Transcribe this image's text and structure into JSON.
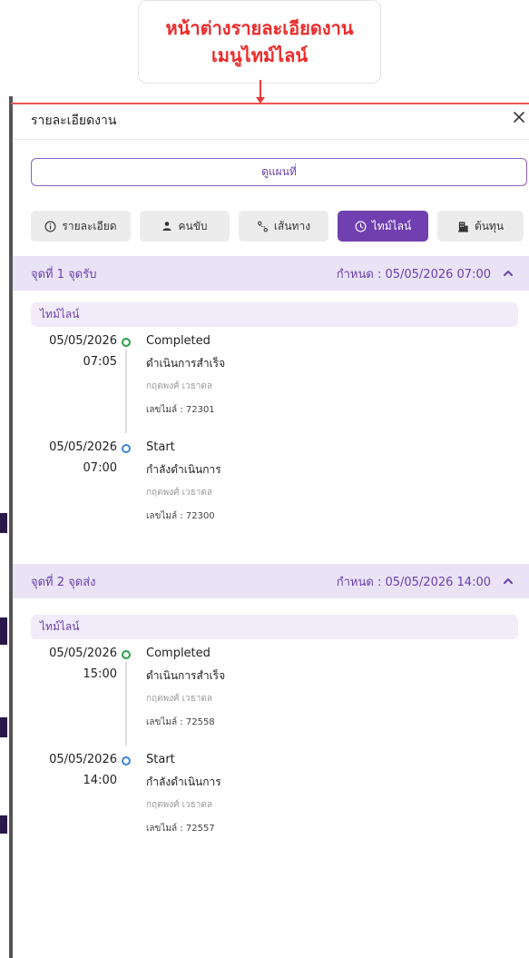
{
  "annotation": {
    "line1": "หน้าต่างรายละเอียดงาน",
    "line2": "เมนูไทม์ไลน์",
    "color": "#ec2b2b"
  },
  "panel": {
    "title": "รายละเอียดงาน",
    "close_icon": "close-icon",
    "map_button": "ดูแผนที่",
    "tabs": [
      {
        "label": "รายละเอียด",
        "icon": "info-icon",
        "active": false
      },
      {
        "label": "คนขับ",
        "icon": "person-icon",
        "active": false
      },
      {
        "label": "เส้นทาง",
        "icon": "route-icon",
        "active": false
      },
      {
        "label": "ไทม์ไลน์",
        "icon": "clock-icon",
        "active": true
      },
      {
        "label": "ต้นทุน",
        "icon": "building-icon",
        "active": false
      }
    ],
    "accent_color": "#7040b0"
  },
  "stops": [
    {
      "title": "จุดที่ 1 จุดรับ",
      "due": "กำหนด : 05/05/2026 07:00",
      "timeline_label": "ไทม์ไลน์",
      "entries": [
        {
          "date": "05/05/2026",
          "time": "07:05",
          "status": "Completed",
          "description": "ดำเนินการสำเร็จ",
          "person": "กฤตพงศ์ เวธาดล",
          "mileage": "เลขไมล์ : 72301",
          "dot": "green"
        },
        {
          "date": "05/05/2026",
          "time": "07:00",
          "status": "Start",
          "description": "กำลังดำเนินการ",
          "person": "กฤตพงศ์ เวธาดล",
          "mileage": "เลขไมล์ : 72300",
          "dot": "blue"
        }
      ]
    },
    {
      "title": "จุดที่ 2 จุดส่ง",
      "due": "กำหนด : 05/05/2026 14:00",
      "timeline_label": "ไทม์ไลน์",
      "entries": [
        {
          "date": "05/05/2026",
          "time": "15:00",
          "status": "Completed",
          "description": "ดำเนินการสำเร็จ",
          "person": "กฤตพงศ์ เวธาดล",
          "mileage": "เลขไมล์ : 72558",
          "dot": "green"
        },
        {
          "date": "05/05/2026",
          "time": "14:00",
          "status": "Start",
          "description": "กำลังดำเนินการ",
          "person": "กฤตพงศ์ เวธาดล",
          "mileage": "เลขไมล์ : 72557",
          "dot": "blue"
        }
      ]
    }
  ]
}
